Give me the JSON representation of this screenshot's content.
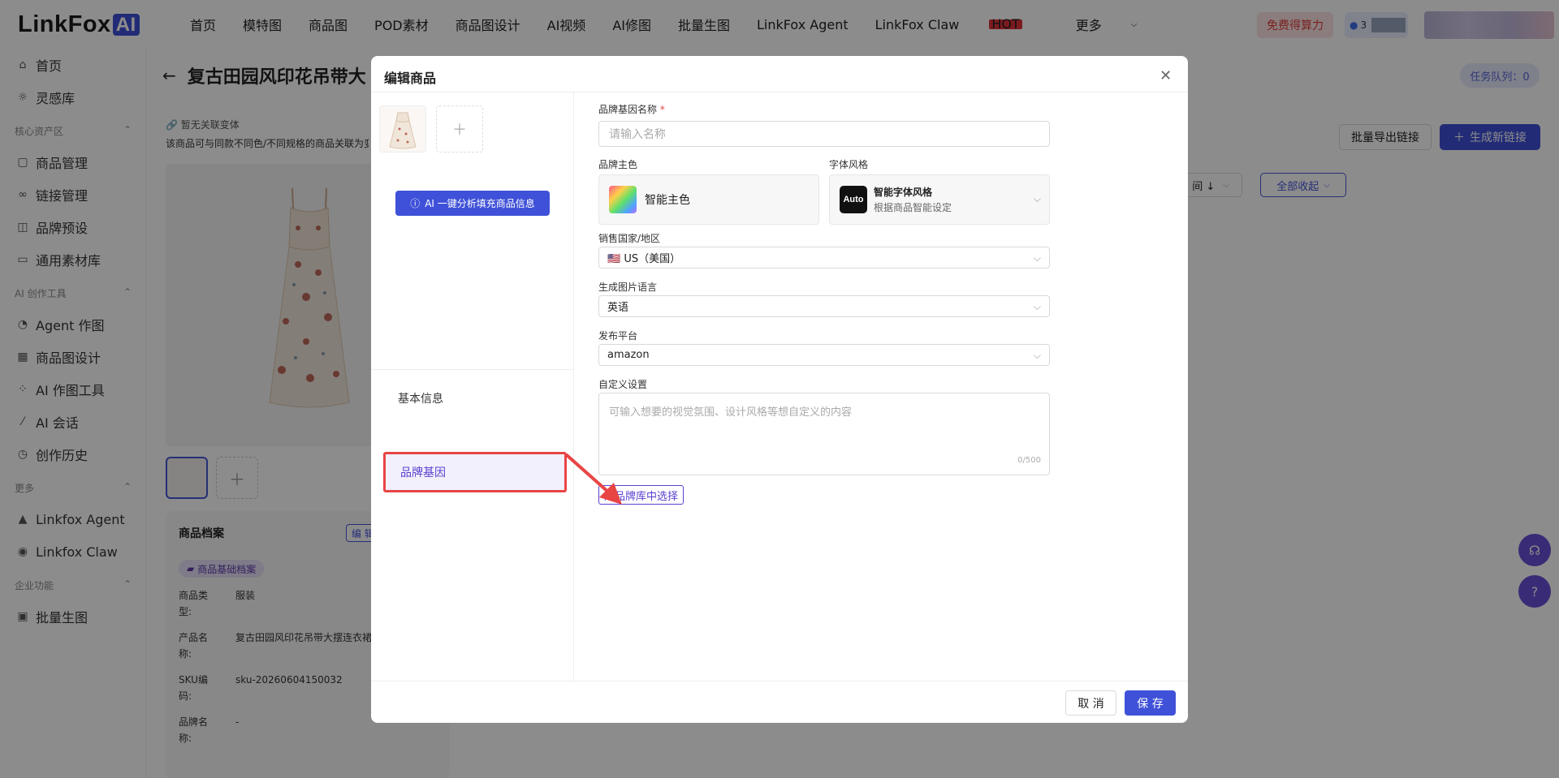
{
  "app": {
    "logo_text": "LinkFox",
    "logo_ai": "AI"
  },
  "nav": [
    "首页",
    "模特图",
    "商品图",
    "POD素材",
    "商品图设计",
    "AI视频",
    "AI修图",
    "批量生图",
    "LinkFox Agent",
    "LinkFox Claw",
    "更多"
  ],
  "nav_hot": "HOT",
  "header": {
    "free_button": "免费得算力",
    "credit_value": "3"
  },
  "sidebar": {
    "items_top": [
      {
        "label": "首页",
        "icon": "home-icon"
      },
      {
        "label": "灵感库",
        "icon": "bulb-icon"
      }
    ],
    "group1": "核心资产区",
    "items_core": [
      {
        "label": "商品管理",
        "icon": "box-icon"
      },
      {
        "label": "链接管理",
        "icon": "link-icon"
      },
      {
        "label": "品牌预设",
        "icon": "bag-icon"
      },
      {
        "label": "通用素材库",
        "icon": "folder-icon"
      }
    ],
    "group2": "AI 创作工具",
    "items_ai": [
      {
        "label": "Agent 作图",
        "icon": "agent-icon"
      },
      {
        "label": "商品图设计",
        "icon": "layout-icon"
      },
      {
        "label": "AI 作图工具",
        "icon": "tools-icon"
      },
      {
        "label": "AI 会话",
        "icon": "wand-icon"
      },
      {
        "label": "创作历史",
        "icon": "history-icon"
      }
    ],
    "group3": "更多",
    "items_more": [
      {
        "label": "Linkfox Agent",
        "icon": "agent-a-icon"
      },
      {
        "label": "Linkfox Claw",
        "icon": "claw-icon"
      }
    ],
    "group4": "企业功能",
    "items_ent": [
      {
        "label": "批量生图",
        "icon": "images-icon"
      }
    ]
  },
  "page": {
    "title": "复古田园风印花吊带大",
    "queue": "任务队列：0",
    "variant_note": "暂无关联变体",
    "variant_desc": "该商品可与同款不同色/不同规格的商品关联为变",
    "export_button": "批量导出链接",
    "new_link_button": "生成新链接",
    "sort_label": "间 ↓",
    "collapse_all": "全部收起",
    "archive": {
      "title": "商品档案",
      "edit": "编 辑",
      "tag": "商品基础档案",
      "rows": [
        {
          "k": "商品类型:",
          "v": "服装"
        },
        {
          "k": "产品名称:",
          "v": "复古田园风印花吊带大摆连衣裙"
        },
        {
          "k": "SKU编码:",
          "v": "sku-20260604150032"
        },
        {
          "k": "品牌名称:",
          "v": "-"
        }
      ]
    }
  },
  "modal": {
    "title": "编辑商品",
    "ai_button": "AI 一键分析填充商品信息",
    "tabs": [
      "基本信息",
      "品牌基因"
    ],
    "fields": {
      "brand_name_label": "品牌基因名称",
      "brand_name_required": "*",
      "brand_name_placeholder": "请输入名称",
      "brand_color_label": "品牌主色",
      "brand_color_value": "智能主色",
      "font_style_label": "字体风格",
      "font_style_icon": "Auto",
      "font_style_title": "智能字体风格",
      "font_style_sub": "根据商品智能设定",
      "country_label": "销售国家/地区",
      "country_value": "🇺🇸 US（美国）",
      "language_label": "生成图片语言",
      "language_value": "英语",
      "platform_label": "发布平台",
      "platform_value": "amazon",
      "custom_label": "自定义设置",
      "custom_placeholder": "可输入想要的视觉氛围、设计风格等想自定义的内容",
      "custom_counter": "0/500",
      "brand_lib_button": "从品牌库中选择"
    },
    "cancel": "取 消",
    "save": "保 存"
  },
  "colors": {
    "primary": "#3f51d8",
    "purple": "#5b3fd0",
    "highlight": "#e84545"
  }
}
